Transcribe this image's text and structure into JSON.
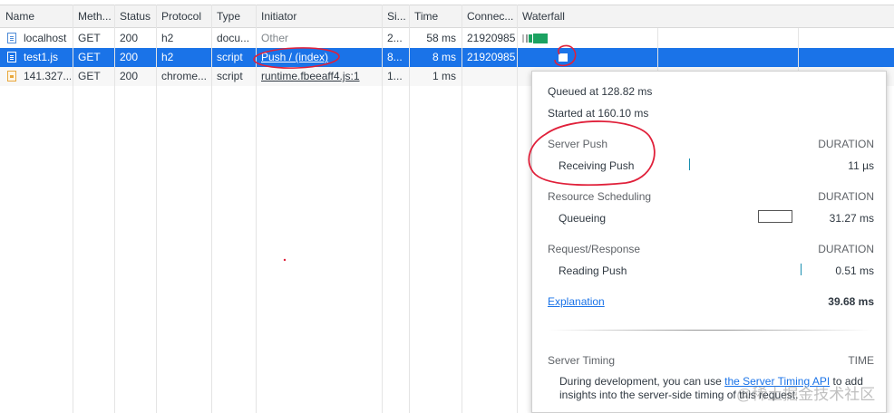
{
  "columns": [
    "Name",
    "Meth...",
    "Status",
    "Protocol",
    "Type",
    "Initiator",
    "Si...",
    "Time",
    "Connec...",
    "Waterfall"
  ],
  "rows": [
    {
      "name": "localhost",
      "method": "GET",
      "status": "200",
      "protocol": "h2",
      "type": "docu...",
      "initiator": "Other",
      "size": "2...",
      "time": "58 ms",
      "connection": "21920985",
      "icon": "document-icon",
      "selected": false
    },
    {
      "name": "test1.js",
      "method": "GET",
      "status": "200",
      "protocol": "h2",
      "type": "script",
      "initiator": "Push / (index)",
      "size": "8...",
      "time": "8 ms",
      "connection": "21920985",
      "icon": "script-icon",
      "selected": true
    },
    {
      "name": "141.327...",
      "method": "GET",
      "status": "200",
      "protocol": "chrome...",
      "type": "script",
      "initiator": "runtime.fbeeaff4.js:1",
      "size": "1...",
      "time": "1 ms",
      "connection": "",
      "icon": "image-icon",
      "selected": false
    }
  ],
  "timing": {
    "queued": "Queued at 128.82 ms",
    "started": "Started at 160.10 ms",
    "sections": [
      {
        "title": "Server Push",
        "duration_label": "DURATION",
        "items": [
          {
            "label": "Receiving Push",
            "value": "11 µs"
          }
        ]
      },
      {
        "title": "Resource Scheduling",
        "duration_label": "DURATION",
        "items": [
          {
            "label": "Queueing",
            "value": "31.27 ms"
          }
        ]
      },
      {
        "title": "Request/Response",
        "duration_label": "DURATION",
        "items": [
          {
            "label": "Reading Push",
            "value": "0.51 ms"
          }
        ]
      }
    ],
    "explanation": "Explanation",
    "total": "39.68 ms",
    "server_timing": {
      "title": "Server Timing",
      "time_label": "TIME",
      "note_before": "During development, you can use ",
      "note_link": "the Server Timing API",
      "note_after": " to add insights into the server-side timing of this request."
    }
  },
  "watermark": "@稀土掘金技术社区",
  "colors": {
    "selected_row": "#1a73e8",
    "waterfall_green": "#1ba261",
    "annotation_red": "#e0203a"
  }
}
